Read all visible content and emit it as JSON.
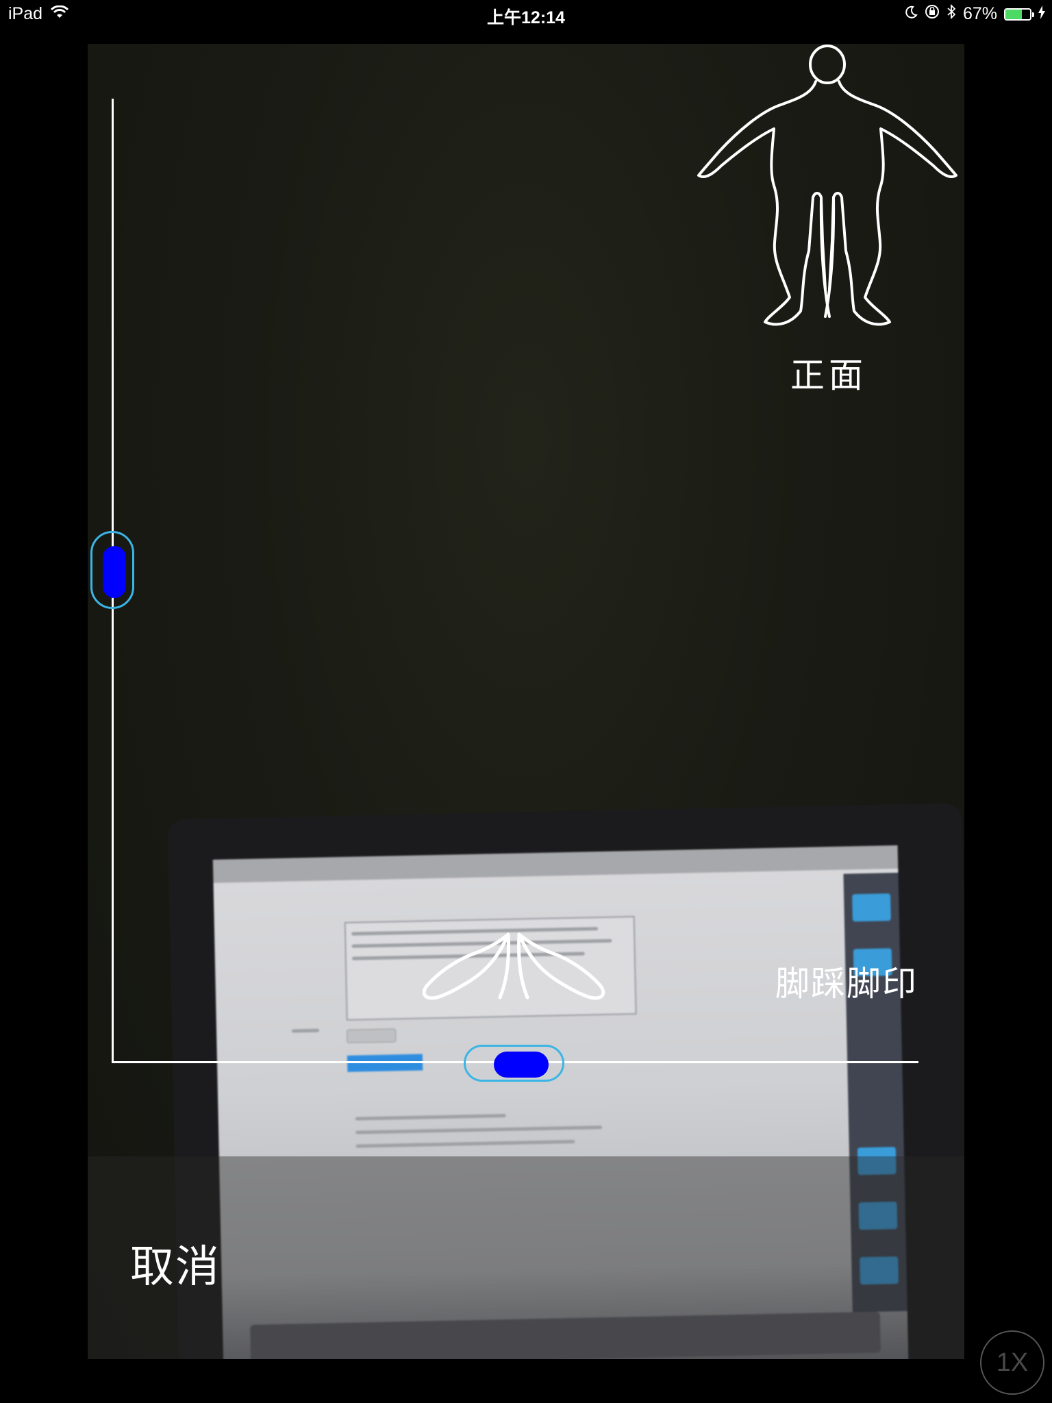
{
  "status_bar": {
    "device": "iPad",
    "time": "上午12:14",
    "battery": "67%",
    "battery_level": 0.67,
    "icons": [
      "wifi-icon",
      "moon-icon",
      "orientation-lock-icon",
      "bluetooth-icon",
      "battery-icon",
      "charging-icon"
    ]
  },
  "overlay": {
    "pose_label": "正面",
    "footprint_label": "脚踩脚印",
    "body_outline_icon": "body-front-outline-icon",
    "feet_outline_icon": "footprint-outline-icon"
  },
  "controls": {
    "cancel_label": "取消",
    "zoom_label": "1X"
  },
  "colors": {
    "handle_knob": "#0000ff",
    "handle_ring": "#3bb5e5",
    "guide_line": "#ffffff"
  }
}
